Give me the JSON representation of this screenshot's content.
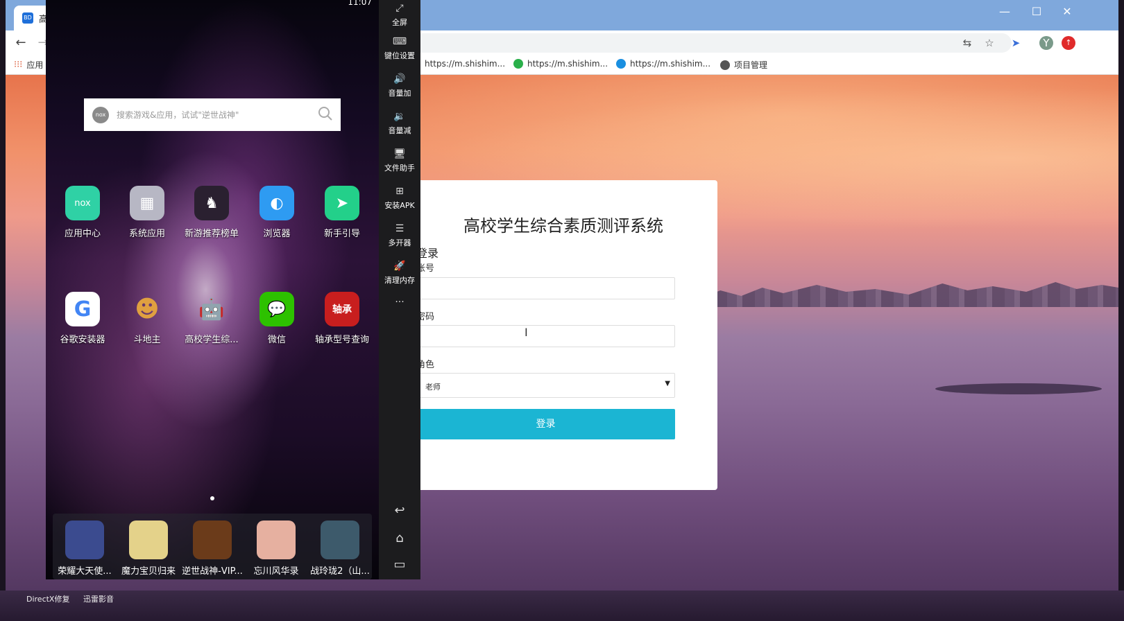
{
  "browser": {
    "tab_title": "高校",
    "tab_favicon": "BD",
    "window_controls": {
      "minimize": "—",
      "maximize": "☐",
      "close": "✕"
    },
    "nav": {
      "back": "←",
      "forward": "→"
    },
    "bookmarks_apps_label": "应用",
    "bookmarks": [
      {
        "label": "https://m.shishim...",
        "color": "#777777"
      },
      {
        "label": "https://m.shishim...",
        "color": "#2ab04a"
      },
      {
        "label": "https://m.shishim...",
        "color": "#1a8fe0"
      },
      {
        "label": "项目管理",
        "color": "#555555"
      }
    ]
  },
  "login": {
    "title": "高校学生综合素质测评系统",
    "heading": "登录",
    "account_label": "账号",
    "password_label": "密码",
    "role_label": "角色",
    "role_value": "老师",
    "button_label": "登录"
  },
  "emulator": {
    "status_time": "11:07",
    "search_placeholder": "搜索游戏&应用，试试\"逆世战神\"",
    "search_logo": "nox",
    "apps_row1": [
      {
        "label": "应用中心",
        "color": "#2fd1a5",
        "glyph": "nox"
      },
      {
        "label": "系统应用",
        "color": "#b7b7c4",
        "glyph": "▦"
      },
      {
        "label": "新游推荐榜单",
        "color": "#2a2030",
        "glyph": "♞"
      },
      {
        "label": "浏览器",
        "color": "#2e9bf2",
        "glyph": "◐"
      },
      {
        "label": "新手引导",
        "color": "#23d08a",
        "glyph": "➤"
      }
    ],
    "apps_row2": [
      {
        "label": "谷歌安装器",
        "color": "#ffffff",
        "glyph": "G"
      },
      {
        "label": "斗地主",
        "color": "#c77a2a",
        "glyph": "☻"
      },
      {
        "label": "高校学生综...",
        "color": "#7cb342",
        "glyph": "🤖"
      },
      {
        "label": "微信",
        "color": "#2dc100",
        "glyph": "💬"
      },
      {
        "label": "轴承型号查询",
        "color": "#c81e1e",
        "glyph": "轴承"
      }
    ],
    "dock": [
      {
        "label": "荣耀大天使...",
        "color": "#3b4b8f"
      },
      {
        "label": "魔力宝贝归来",
        "color": "#e4d28a"
      },
      {
        "label": "逆世战神-VIP...",
        "color": "#6b3b1a"
      },
      {
        "label": "忘川风华录",
        "color": "#e6b0a0"
      },
      {
        "label": "战玲珑2（山...",
        "color": "#3d5a6b"
      }
    ],
    "sidebar": [
      {
        "icon": "⤢",
        "label": "全屏"
      },
      {
        "icon": "⌨",
        "label": "键位设置"
      },
      {
        "icon": "🔊",
        "label": "音量加"
      },
      {
        "icon": "🔉",
        "label": "音量减"
      },
      {
        "icon": "🖥",
        "label": "文件助手"
      },
      {
        "icon": "⊞",
        "label": "安装APK"
      },
      {
        "icon": "☰",
        "label": "多开器"
      },
      {
        "icon": "🚀",
        "label": "清理内存"
      },
      {
        "icon": "···",
        "label": ""
      }
    ],
    "nav_keys": {
      "back": "↩",
      "home": "⌂",
      "recent": "▭"
    }
  },
  "taskbar": {
    "items": [
      "DirectX修复",
      "迅雷影音"
    ]
  }
}
